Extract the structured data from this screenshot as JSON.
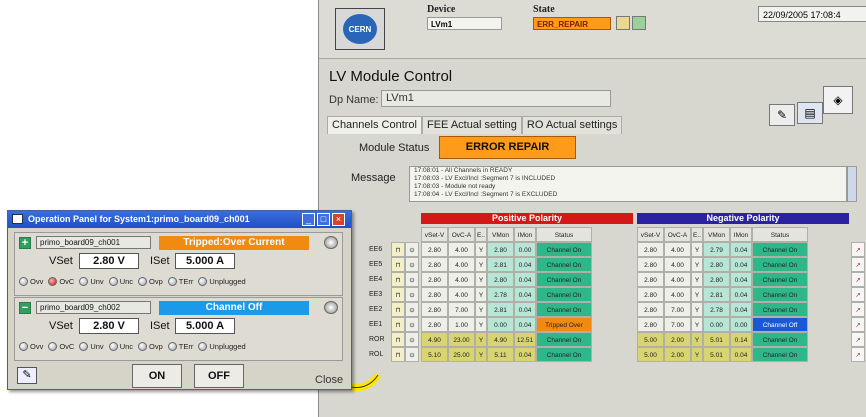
{
  "header": {
    "device_label": "Device",
    "device_value": "LVm1",
    "state_label": "State",
    "state_value": "ERR_REPAIR",
    "timestamp": "22/09/2005 17:08:4",
    "logo_text": "CERN"
  },
  "module": {
    "title": "LV Module Control",
    "dp_label": "Dp Name:",
    "dp_value": "LVm1",
    "tabs": [
      "Channels Control",
      "FEE Actual setting",
      "RO Actual settings"
    ],
    "status_label": "Module Status",
    "status_value": "ERROR REPAIR",
    "message_label": "Message",
    "messages": [
      "17:08:01 - All Channels in READY",
      "17:08:03 - LV Excl/Incl :Segment 7 is INCLUDED",
      "17:08:03 - Module not ready",
      "17:08:04 - LV Excl/Incl :Segment 7 is EXCLUDED"
    ]
  },
  "grid": {
    "positive_title": "Positive Polarity",
    "negative_title": "Negative Polarity",
    "columns": [
      "vSet-V",
      "OvC-A",
      "E..",
      "VMon",
      "IMon",
      "Status"
    ],
    "rows": [
      {
        "label": "EE6",
        "pos": [
          "2.80",
          "4.00",
          "Y",
          "2.80",
          "0.00",
          "Channel On"
        ],
        "neg": [
          "2.80",
          "4.00",
          "Y",
          "2.79",
          "0.04",
          "Channel On"
        ]
      },
      {
        "label": "EE5",
        "pos": [
          "2.80",
          "4.00",
          "Y",
          "2.81",
          "0.04",
          "Channel On"
        ],
        "neg": [
          "2.80",
          "4.00",
          "Y",
          "2.80",
          "0.04",
          "Channel On"
        ]
      },
      {
        "label": "EE4",
        "pos": [
          "2.80",
          "4.00",
          "Y",
          "2.80",
          "0.04",
          "Channel On"
        ],
        "neg": [
          "2.80",
          "4.00",
          "Y",
          "2.80",
          "0.04",
          "Channel On"
        ]
      },
      {
        "label": "EE3",
        "pos": [
          "2.80",
          "4.00",
          "Y",
          "2.78",
          "0.04",
          "Channel On"
        ],
        "neg": [
          "2.80",
          "4.00",
          "Y",
          "2.81",
          "0.04",
          "Channel On"
        ]
      },
      {
        "label": "EE2",
        "pos": [
          "2.80",
          "7.00",
          "Y",
          "2.81",
          "0.04",
          "Channel On"
        ],
        "neg": [
          "2.80",
          "7.00",
          "Y",
          "2.78",
          "0.04",
          "Channel On"
        ]
      },
      {
        "label": "EE1",
        "pos": [
          "2.80",
          "1.00",
          "Y",
          "0.00",
          "0.04",
          "Tripped Over"
        ],
        "neg": [
          "2.80",
          "7.00",
          "Y",
          "0.00",
          "0.00",
          "Channel Off"
        ]
      },
      {
        "label": "ROR",
        "pos": [
          "4.90",
          "23.00",
          "Y",
          "4.90",
          "12.51",
          "Channel On"
        ],
        "neg": [
          "5.00",
          "2.00",
          "Y",
          "5.01",
          "0.14",
          "Channel On"
        ]
      },
      {
        "label": "ROL",
        "pos": [
          "5.10",
          "25.00",
          "Y",
          "5.11",
          "0.04",
          "Channel On"
        ],
        "neg": [
          "5.00",
          "2.00",
          "Y",
          "5.01",
          "0.04",
          "Channel On"
        ]
      }
    ]
  },
  "panel": {
    "title": "Operation Panel for System1:primo_board09_ch001",
    "channels": [
      {
        "sign": "+",
        "name": "primo_board09_ch001",
        "state": "Tripped:Over Current",
        "state_color": "#f08a10",
        "vset_label": "VSet",
        "vset": "2.80 V",
        "iset_label": "ISet",
        "iset": "5.000 A"
      },
      {
        "sign": "−",
        "name": "primo_board09_ch002",
        "state": "Channel Off",
        "state_color": "#1a9ae8",
        "vset_label": "VSet",
        "vset": "2.80 V",
        "iset_label": "ISet",
        "iset": "5.000 A"
      }
    ],
    "flags": [
      "Ovv",
      "OvC",
      "Unv",
      "Unc",
      "Ovp",
      "TErr",
      "Unplugged"
    ],
    "on_label": "ON",
    "off_label": "OFF",
    "close_label": "Close"
  },
  "colors": {
    "positive_header": "#d41818",
    "negative_header": "#2a22a0",
    "channel_on": "#2eb88a",
    "tripped": "#f08a10",
    "channel_off": "#1a58d8",
    "ro_row": "#d8d470",
    "error_state": "#ff9b1a"
  }
}
